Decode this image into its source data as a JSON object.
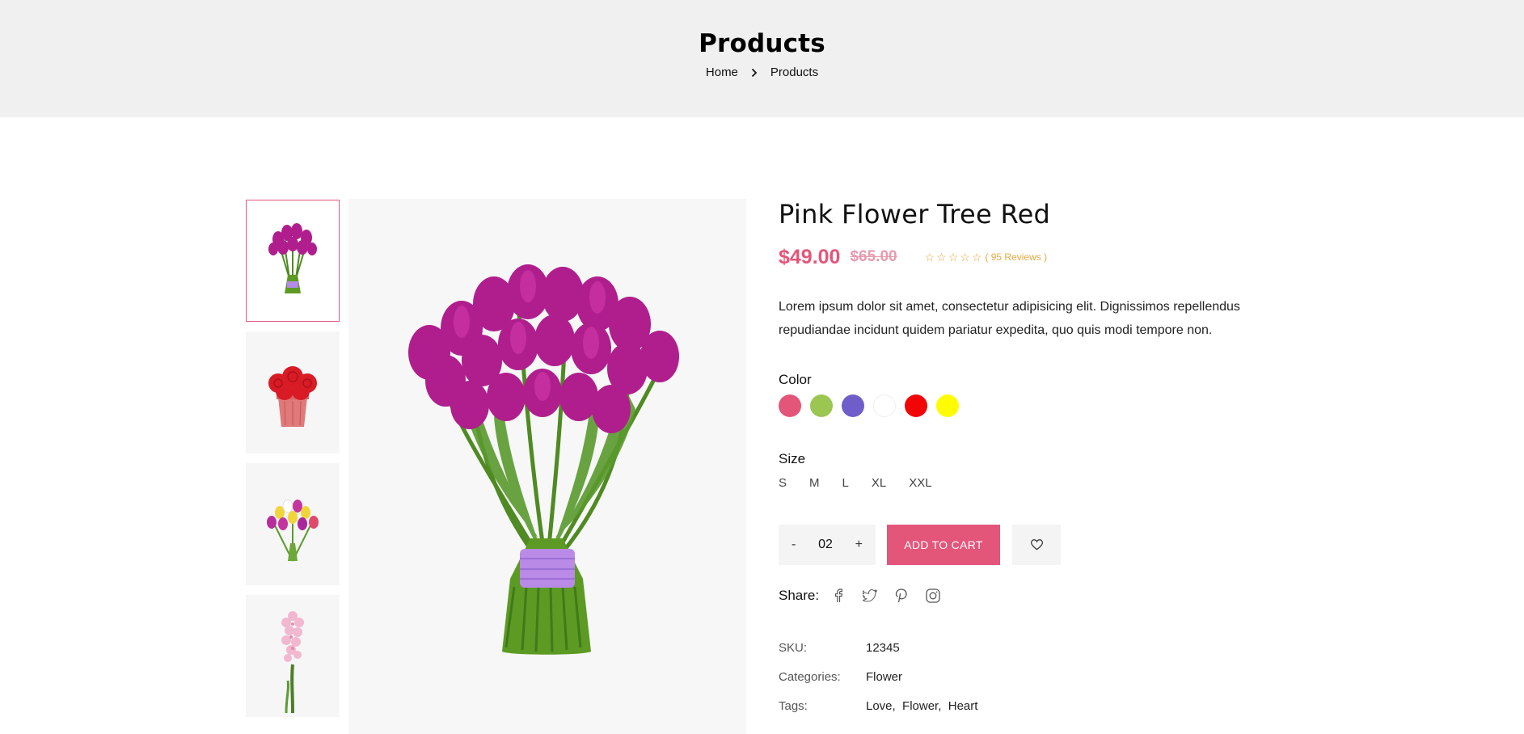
{
  "header": {
    "title": "Products",
    "breadcrumb": {
      "home": "Home",
      "current": "Products"
    }
  },
  "gallery": {
    "thumbnails": [
      {
        "name": "purple-tulip-bouquet",
        "active": true
      },
      {
        "name": "red-roses-in-pot",
        "active": false
      },
      {
        "name": "mixed-tulip-bouquet",
        "active": false
      },
      {
        "name": "pink-hyacinth",
        "active": false
      }
    ],
    "main_image": "purple-tulip-bouquet"
  },
  "product": {
    "title": "Pink Flower Tree Red",
    "price": "$49.00",
    "old_price": "$65.00",
    "rating": 0,
    "rating_max": 5,
    "reviews": "( 95 Reviews )",
    "description": "Lorem ipsum dolor sit amet, consectetur adipisicing elit. Dignissimos repellendus repudiandae incidunt quidem pariatur expedita, quo quis modi tempore non.",
    "color_label": "Color",
    "colors": [
      "#e4557a",
      "#9cc652",
      "#6f5ec9",
      "#ffffff",
      "#f20505",
      "#fffb00"
    ],
    "size_label": "Size",
    "sizes": [
      "S",
      "M",
      "L",
      "XL",
      "XXL"
    ],
    "quantity": "02",
    "minus_label": "-",
    "plus_label": "+",
    "add_to_cart": "ADD TO CART",
    "share_label": "Share:",
    "social_icons": [
      "facebook-icon",
      "twitter-icon",
      "pinterest-icon",
      "instagram-icon"
    ],
    "meta": {
      "sku_label": "SKU:",
      "sku": "12345",
      "categories_label": "Categories:",
      "category": "Flower",
      "tags_label": "Tags:",
      "tags": [
        "Love",
        "Flower",
        "Heart"
      ]
    }
  },
  "colors": {
    "accent": "#e4557a",
    "header_bg": "#f0f0f0",
    "star": "#e8a840"
  }
}
